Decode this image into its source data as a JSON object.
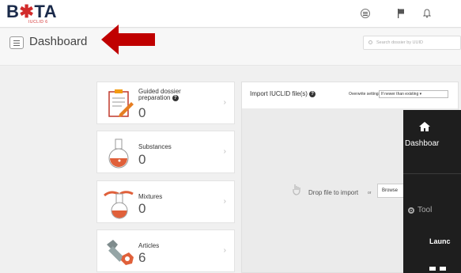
{
  "topbar": {
    "logo_text_1": "B",
    "logo_text_2": "TA",
    "logo_sub": "IUCLID 6",
    "icons": [
      "apps-menu-icon",
      "flag-icon",
      "bell-icon"
    ]
  },
  "header": {
    "title": "Dashboard",
    "search_placeholder": "Search dossier by UUID"
  },
  "cards": [
    {
      "label": "Guided dossier preparation",
      "has_help": true,
      "count": "0",
      "icon": "clipboard-pencil-icon"
    },
    {
      "label": "Substances",
      "has_help": false,
      "count": "0",
      "icon": "flask-icon"
    },
    {
      "label": "Mixtures",
      "has_help": false,
      "count": "0",
      "icon": "mixture-flask-icon"
    },
    {
      "label": "Articles",
      "has_help": false,
      "count": "6",
      "icon": "bolt-nut-icon"
    }
  ],
  "import": {
    "title": "Import IUCLID file(s)",
    "overwrite_label": "Overwrite settings",
    "overwrite_value": "If newer than existing",
    "drop_text": "Drop file to import",
    "or_text": "or",
    "browse_label": "Browse"
  },
  "side_menu": {
    "dashboard_label": "Dashboar",
    "tools_label": "Tool",
    "launch_label": "Launc"
  },
  "colors": {
    "brand_red": "#d22b2b",
    "arrow_red": "#c00000",
    "side_dark": "#1e1e1e"
  }
}
